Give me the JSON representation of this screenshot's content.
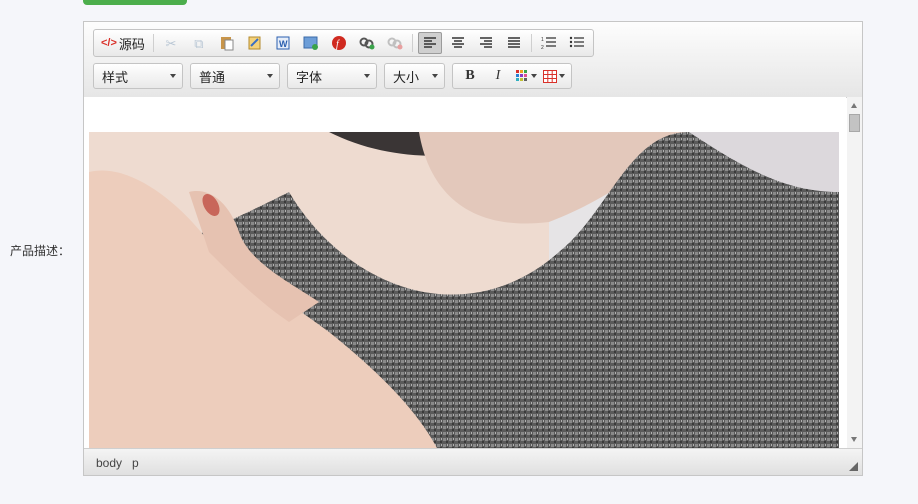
{
  "form": {
    "label": "产品描述："
  },
  "toolbar": {
    "source_label": "源码",
    "row1_icons": [
      {
        "name": "cut-icon",
        "glyph": "✂",
        "disabled": true
      },
      {
        "name": "copy-icon",
        "glyph": "⧉",
        "disabled": true
      },
      {
        "name": "paste-icon",
        "glyph": "📋",
        "disabled": false
      },
      {
        "name": "paste-text-icon",
        "glyph": "📝",
        "disabled": false
      },
      {
        "name": "paste-word-icon",
        "glyph": "W",
        "disabled": false
      },
      {
        "name": "insert-image-icon",
        "glyph": "🖼",
        "disabled": false
      },
      {
        "name": "flash-icon",
        "glyph": "ƒ",
        "disabled": false
      },
      {
        "name": "link-icon",
        "glyph": "🔗",
        "disabled": false
      },
      {
        "name": "unlink-icon",
        "glyph": "⛓",
        "disabled": true
      }
    ],
    "align_icons": [
      {
        "name": "align-left-icon",
        "glyph": "≡",
        "active": true
      },
      {
        "name": "align-center-icon",
        "glyph": "≡",
        "active": false
      },
      {
        "name": "align-right-icon",
        "glyph": "≡",
        "active": false
      },
      {
        "name": "align-justify-icon",
        "glyph": "≡",
        "active": false
      }
    ],
    "list_icons": [
      {
        "name": "ordered-list-icon",
        "glyph": "☰"
      },
      {
        "name": "unordered-list-icon",
        "glyph": "☰"
      }
    ],
    "style_combo": "样式",
    "format_combo": "普通",
    "font_combo": "字体",
    "size_combo": "大小",
    "bold_label": "B",
    "italic_label": "I"
  },
  "statusbar": {
    "path": [
      "body",
      "p"
    ]
  },
  "colors": {
    "accent_green": "#4cae4c",
    "source_icon_red": "#d9312a"
  }
}
